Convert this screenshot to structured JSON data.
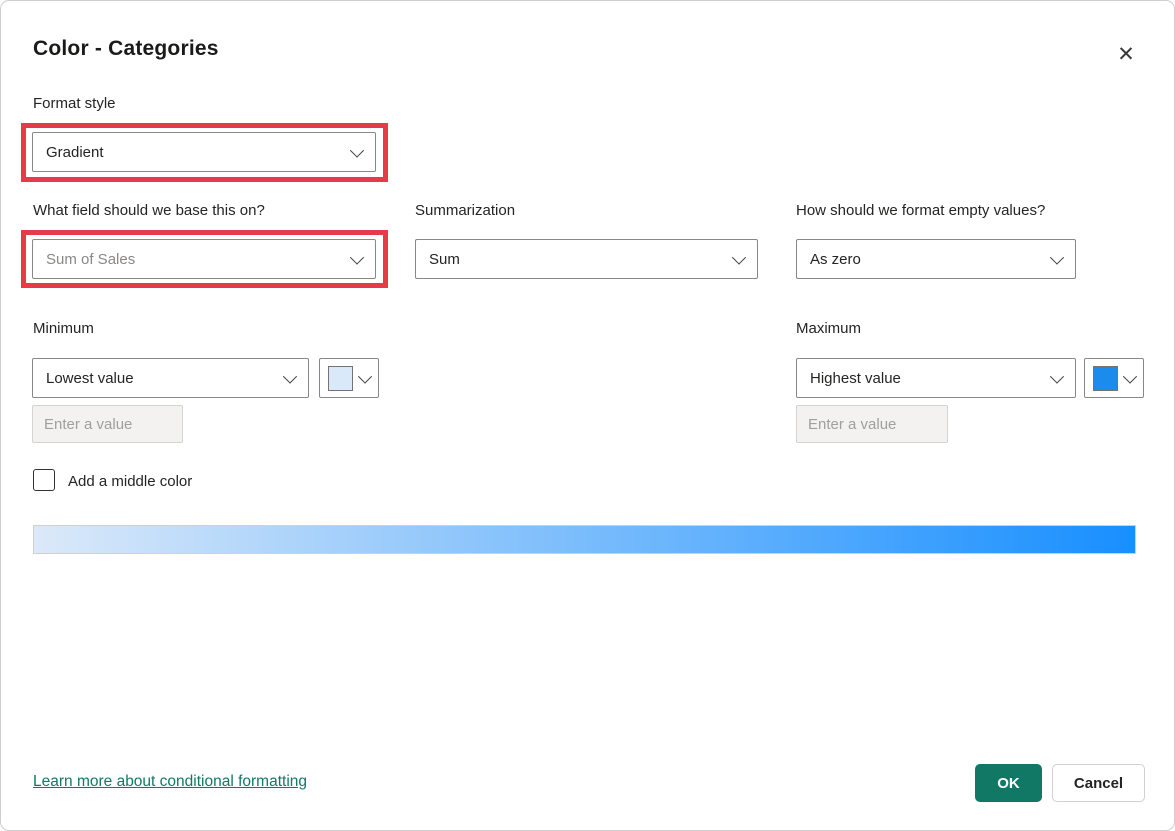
{
  "dialog": {
    "title": "Color - Categories",
    "close_glyph": "✕"
  },
  "format_style": {
    "label": "Format style",
    "value": "Gradient"
  },
  "field": {
    "label": "What field should we base this on?",
    "value": "Sum of Sales"
  },
  "summarization": {
    "label": "Summarization",
    "value": "Sum"
  },
  "empty_values": {
    "label": "How should we format empty values?",
    "value": "As zero"
  },
  "minimum": {
    "label": "Minimum",
    "value": "Lowest value",
    "input_placeholder": "Enter a value",
    "swatch_color": "#d9e9f9"
  },
  "maximum": {
    "label": "Maximum",
    "value": "Highest value",
    "input_placeholder": "Enter a value",
    "swatch_color": "#1b8ceb"
  },
  "middle_color": {
    "label": "Add a middle color",
    "checked": false
  },
  "gradient": {
    "start_color": "#dbe9f9",
    "end_color": "#188fff",
    "css": "linear-gradient(90deg, #dbe9f9 0%, #188fff 100%)"
  },
  "footer": {
    "link": "Learn more about conditional formatting",
    "ok_label": "OK",
    "cancel_label": "Cancel"
  },
  "colors": {
    "annotation_red": "#e83b4a",
    "accent_teal": "#117865",
    "link_teal": "#117865"
  }
}
